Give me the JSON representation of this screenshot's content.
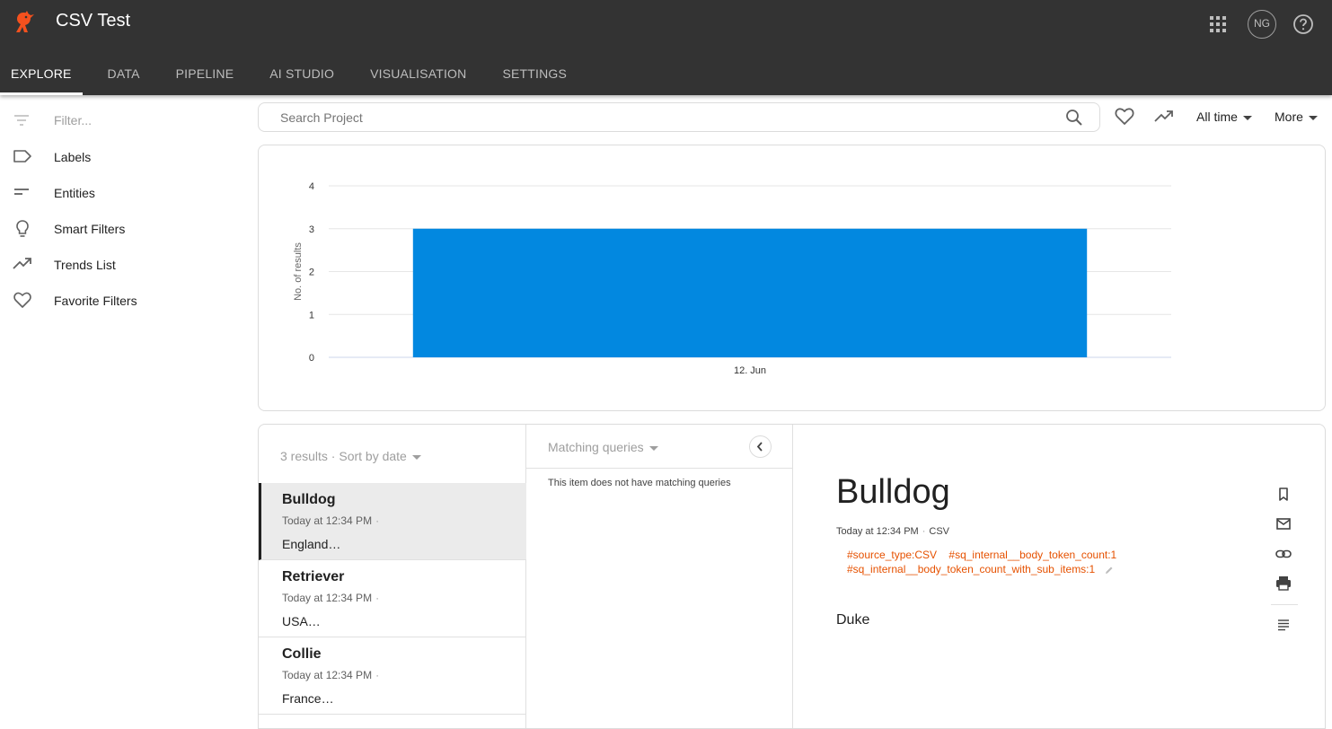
{
  "app": {
    "title": "CSV Test",
    "user_initials": "NG"
  },
  "tabs": [
    {
      "label": "EXPLORE",
      "active": true
    },
    {
      "label": "DATA",
      "active": false
    },
    {
      "label": "PIPELINE",
      "active": false
    },
    {
      "label": "AI STUDIO",
      "active": false
    },
    {
      "label": "VISUALISATION",
      "active": false
    },
    {
      "label": "SETTINGS",
      "active": false
    }
  ],
  "sidebar": {
    "filter_placeholder": "Filter...",
    "items": [
      {
        "label": "Labels",
        "icon": "label-icon"
      },
      {
        "label": "Entities",
        "icon": "entities-icon"
      },
      {
        "label": "Smart Filters",
        "icon": "lightbulb-icon"
      },
      {
        "label": "Trends List",
        "icon": "trending-up-icon"
      },
      {
        "label": "Favorite Filters",
        "icon": "heart-icon"
      }
    ]
  },
  "toolbar": {
    "search_placeholder": "Search Project",
    "time_range": "All time",
    "more_label": "More"
  },
  "chart_data": {
    "type": "bar",
    "categories": [
      "12. Jun"
    ],
    "values": [
      3
    ],
    "ylabel": "No. of results",
    "xlabel": "",
    "ylim": [
      0,
      4
    ],
    "yticks": [
      0,
      1,
      2,
      3,
      4
    ],
    "color": "#0288e0"
  },
  "results": {
    "summary": "3 results · Sort by date",
    "items": [
      {
        "title": "Bulldog",
        "time": "Today at 12:34 PM",
        "snippet": "England…",
        "selected": true
      },
      {
        "title": "Retriever",
        "time": "Today at 12:34 PM",
        "snippet": "USA…",
        "selected": false
      },
      {
        "title": "Collie",
        "time": "Today at 12:34 PM",
        "snippet": "France…",
        "selected": false
      }
    ]
  },
  "matching": {
    "header": "Matching queries",
    "empty_text": "This item does not have matching queries"
  },
  "detail": {
    "title": "Bulldog",
    "time": "Today at 12:34 PM",
    "source": "CSV",
    "tags": [
      "#source_type:CSV",
      "#sq_internal__body_token_count:1",
      "#sq_internal__body_token_count_with_sub_items:1"
    ],
    "body": "Duke"
  },
  "colors": {
    "topbar": "#333333",
    "accent_bar": "#0288e0",
    "tag": "#e65100",
    "logo": "#f4511e"
  }
}
